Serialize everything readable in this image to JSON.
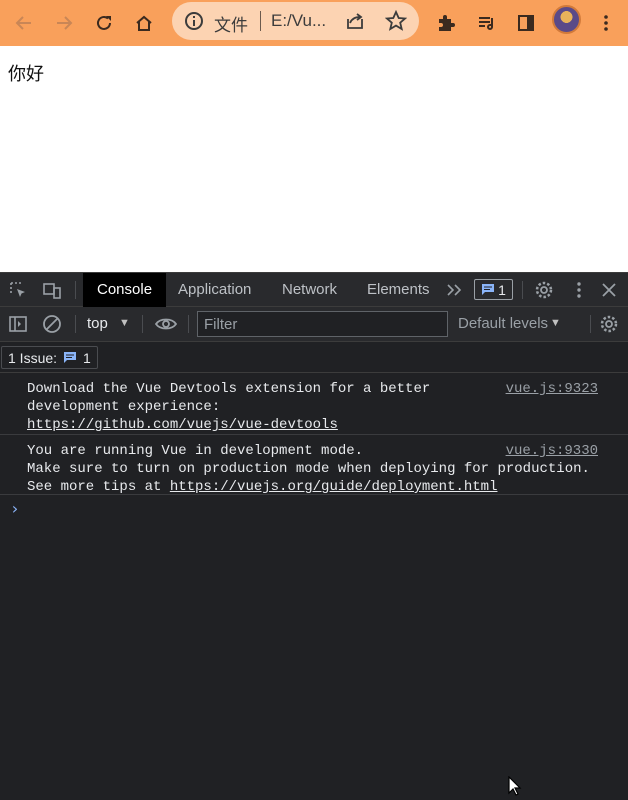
{
  "browser": {
    "scheme_label": "文件",
    "url_text": "E:/Vu...",
    "accent_color": "#f9a05b"
  },
  "page": {
    "greeting": "你好"
  },
  "devtools": {
    "tabs": [
      {
        "label": "Console",
        "active": true
      },
      {
        "label": "Application"
      },
      {
        "label": "Network"
      },
      {
        "label": "Elements"
      }
    ],
    "issue_count": "1",
    "context": "top",
    "filter_placeholder": "Filter",
    "levels": "Default levels",
    "issues_label": "1 Issue:",
    "issues_count": "1",
    "messages": [
      {
        "lines": [
          "Download the Vue Devtools extension for a better",
          "development experience:"
        ],
        "link": "https://github.com/vuejs/vue-devtools",
        "source": "vue.js:9323"
      },
      {
        "lines": [
          "You are running Vue in development mode.",
          "Make sure to turn on production mode when deploying for production."
        ],
        "link_prefix": "See more tips at ",
        "link": "https://vuejs.org/guide/deployment.html",
        "source": "vue.js:9330"
      }
    ],
    "prompt_symbol": "›"
  }
}
